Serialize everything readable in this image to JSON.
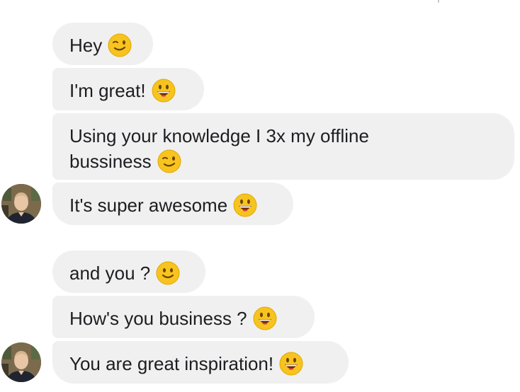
{
  "conversation": {
    "group1": {
      "messages": [
        {
          "text": "Hey",
          "emoji": "winking-face-emoji"
        },
        {
          "text": "I'm great!",
          "emoji": "grinning-face-emoji"
        },
        {
          "text": "Using your knowledge I 3x my offline bussiness",
          "emoji": "winking-face-emoji"
        },
        {
          "text": "It's super awesome",
          "emoji": "grinning-face-emoji"
        }
      ]
    },
    "group2": {
      "messages": [
        {
          "text": "and you ?",
          "emoji": "slightly-smiling-face-emoji"
        },
        {
          "text": "How's you business ?",
          "emoji": "grinning-face-emoji"
        },
        {
          "text": "You are great inspiration!",
          "emoji": "grinning-face-emoji"
        }
      ]
    }
  },
  "colors": {
    "bubble_bg": "#f1f0f0",
    "text": "#1c1e21",
    "emoji_yellow": "#f7c31f"
  }
}
